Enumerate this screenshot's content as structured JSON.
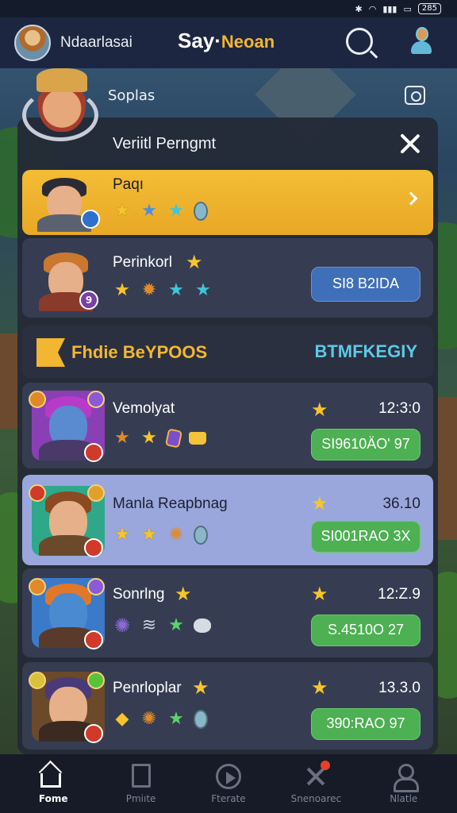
{
  "status_bar": {
    "battery": "285"
  },
  "header": {
    "username": "Ndaarlasai",
    "brand_part1": "Say·",
    "brand_part2": "Neoan"
  },
  "hero": {
    "label": "Soplas"
  },
  "panel": {
    "title": "Veriitl Perngmt",
    "featured": [
      {
        "name": "Paqı",
        "level": ""
      },
      {
        "name": "Perinkorl",
        "level": "9",
        "price": "SI8 B2IDA"
      }
    ],
    "section": {
      "left_label": "Fhdie BeYPOOS",
      "right_label": "BTMFKEGIY"
    },
    "list": [
      {
        "name": "Vemolyat",
        "time": "12:3:0",
        "price": "SI9610ÄO' 97"
      },
      {
        "name": "Manla Reapbnag",
        "time": "36.10",
        "price": "SI001RAO 3X"
      },
      {
        "name": "Sonrlng",
        "time": "12:Z.9",
        "price": "S.4510O 27"
      },
      {
        "name": "Penrloplar",
        "time": "13.3.0",
        "price": "390:RAO 97"
      }
    ]
  },
  "nav": [
    {
      "label": "Fome",
      "icon": "home-icon",
      "active": true
    },
    {
      "label": "Pmiıte",
      "icon": "book-icon",
      "active": false
    },
    {
      "label": "Fterate",
      "icon": "play-icon",
      "active": false
    },
    {
      "label": "Snenoarec",
      "icon": "combat-icon",
      "active": false
    },
    {
      "label": "Nlatle",
      "icon": "person-icon",
      "active": false
    }
  ],
  "colors": {
    "accent_gold": "#f4bd36",
    "accent_green": "#4db052",
    "accent_blue": "#3f6fb8",
    "panel_bg": "#242936"
  }
}
